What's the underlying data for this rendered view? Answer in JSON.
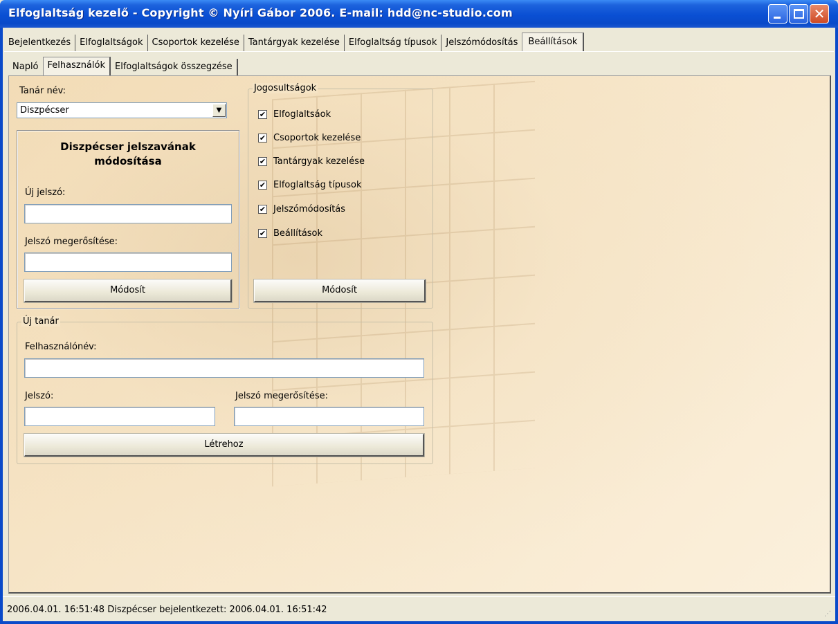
{
  "window": {
    "title": "Elfoglaltság kezelő - Copyright © Nyíri Gábor 2006. E-mail: hdd@nc-studio.com",
    "close_glyph": "✕"
  },
  "main_tabs": [
    {
      "label": "Bejelentkezés"
    },
    {
      "label": "Elfoglaltságok"
    },
    {
      "label": "Csoportok kezelése"
    },
    {
      "label": "Tantárgyak kezelése"
    },
    {
      "label": "Elfoglaltság típusok"
    },
    {
      "label": "Jelszómódosítás"
    },
    {
      "label": "Beállítások",
      "active": true
    }
  ],
  "sub_tabs": [
    {
      "label": "Napló"
    },
    {
      "label": "Felhasználók",
      "active": true
    },
    {
      "label": "Elfoglaltságok összegzése"
    }
  ],
  "teacher": {
    "label": "Tanár név:",
    "selected": "Diszpécser",
    "arrow": "▼"
  },
  "password_change": {
    "heading_line1": "Diszpécser jelszavának",
    "heading_line2": "módosítása",
    "new_password_label": "Új jelszó:",
    "new_password_value": "",
    "confirm_label": "Jelszó megerősítése:",
    "confirm_value": "",
    "submit_label": "Módosít"
  },
  "permissions": {
    "legend": "Jogosultságok",
    "check_glyph": "✔",
    "items": [
      {
        "label": "Elfoglaltsáok",
        "checked": true
      },
      {
        "label": "Csoportok kezelése",
        "checked": true
      },
      {
        "label": "Tantárgyak kezelése",
        "checked": true
      },
      {
        "label": "Elfoglaltság típusok",
        "checked": true
      },
      {
        "label": "Jelszómódosítás",
        "checked": true
      },
      {
        "label": "Beállítások",
        "checked": true
      }
    ],
    "submit_label": "Módosít"
  },
  "new_teacher": {
    "legend": "Új tanár",
    "username_label": "Felhasználónév:",
    "username_value": "",
    "password_label": "Jelszó:",
    "password_value": "",
    "confirm_label": "Jelszó megerősítése:",
    "confirm_value": "",
    "create_label": "Létrehoz"
  },
  "status": {
    "text": "2006.04.01. 16:51:48  Diszpécser bejelentkezett: 2006.04.01. 16:51:42"
  },
  "colors": {
    "titlebar": "#0a4ac9",
    "client_bg": "#f7e6c9",
    "face": "#ece9d8"
  }
}
